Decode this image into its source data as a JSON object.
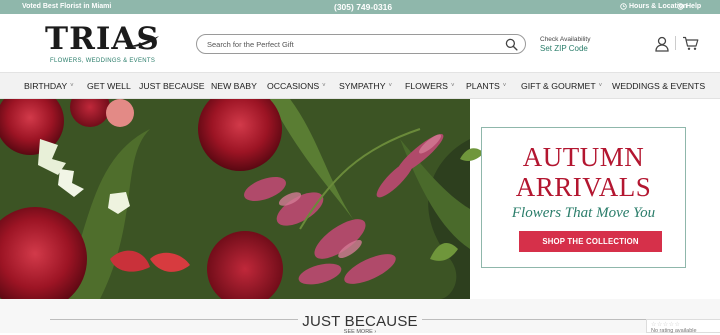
{
  "topbar": {
    "voted": "Voted Best Florist in Miami",
    "phone": "(305) 749-0316",
    "hours": "Hours & Location",
    "help": "Help"
  },
  "logo": {
    "name": "TRIAS",
    "tagline": "FLOWERS, WEDDINGS & EVENTS"
  },
  "search": {
    "placeholder": "Search for the Perfect Gift"
  },
  "availability": {
    "line1": "Check Availability",
    "line2": "Set ZIP Code"
  },
  "nav": [
    {
      "label": "BIRTHDAY",
      "caret": "˅"
    },
    {
      "label": "GET WELL",
      "caret": ""
    },
    {
      "label": "JUST BECAUSE",
      "caret": ""
    },
    {
      "label": "NEW BABY",
      "caret": ""
    },
    {
      "label": "OCCASIONS",
      "caret": "˅"
    },
    {
      "label": "SYMPATHY",
      "caret": "˅"
    },
    {
      "label": "FLOWERS",
      "caret": "˅"
    },
    {
      "label": "PLANTS",
      "caret": "˅"
    },
    {
      "label": "GIFT & GOURMET",
      "caret": "˅"
    },
    {
      "label": "WEDDINGS & EVENTS",
      "caret": ""
    }
  ],
  "promo": {
    "line1": "AUTUMN",
    "line2": "ARRIVALS",
    "subtitle": "Flowers That Move You",
    "button": "SHOP THE COLLECTION"
  },
  "section": {
    "title": "JUST BECAUSE",
    "see_more": "SEE MORE ›"
  },
  "rating_widget": {
    "stars": "☆☆☆☆☆",
    "text": "No rating available"
  },
  "colors": {
    "topbar": "#8fb7ab",
    "accent_green": "#2a7d6a",
    "accent_red": "#b31630",
    "button_red": "#d6304a"
  }
}
